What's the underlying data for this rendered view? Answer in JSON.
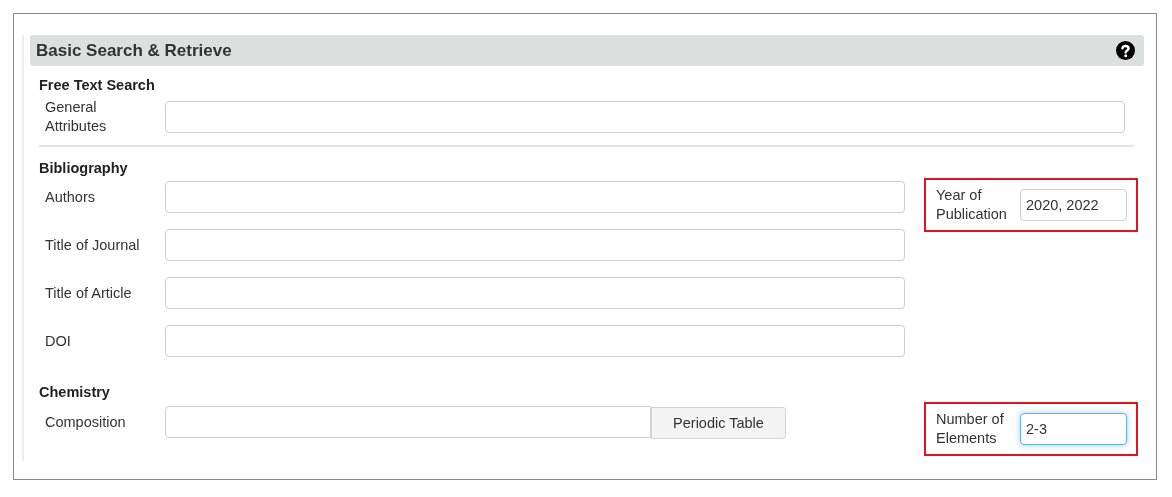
{
  "panel": {
    "title": "Basic Search & Retrieve"
  },
  "sections": [
    {
      "heading": "Free Text Search",
      "divider_after": true,
      "fields": [
        {
          "label": "General Attributes",
          "wide": true
        }
      ]
    },
    {
      "heading": "Bibliography",
      "divider_after": false,
      "fields": [
        {
          "label": "Authors"
        },
        {
          "label": "Title of Journal"
        },
        {
          "label": "Title of Article"
        },
        {
          "label": "DOI"
        }
      ],
      "side": {
        "label": "Year of Publication",
        "value": "2020, 2022",
        "highlighted": true,
        "focused": false
      }
    },
    {
      "heading": "Chemistry",
      "divider_after": false,
      "fields": [
        {
          "label": "Composition",
          "button": "Periodic Table"
        }
      ],
      "side": {
        "label": "Number of Elements",
        "value": "2-3",
        "highlighted": true,
        "focused": true
      }
    }
  ]
}
